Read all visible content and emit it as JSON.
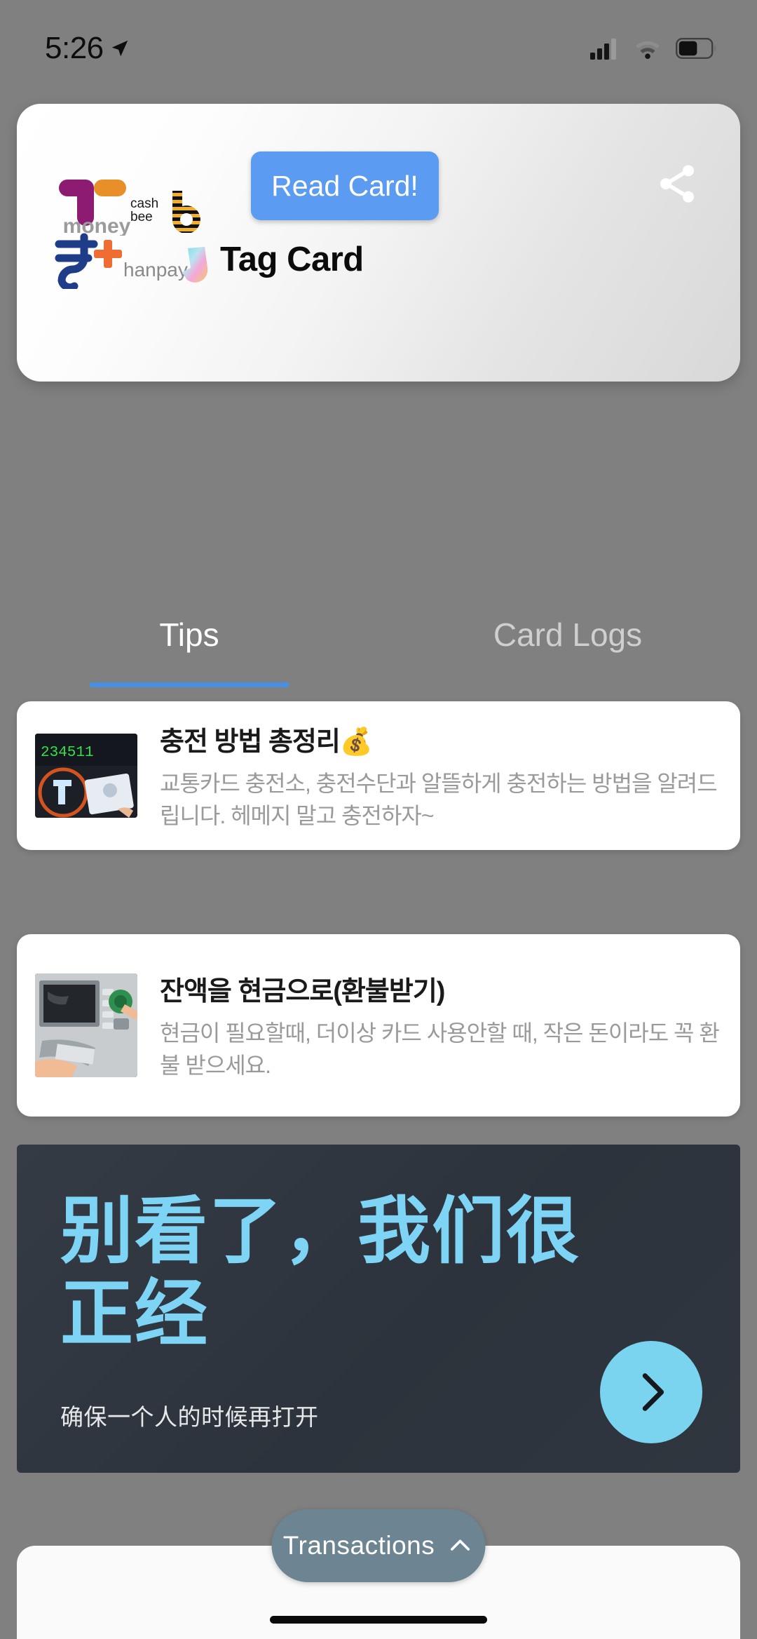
{
  "status_bar": {
    "time": "5:26",
    "location_icon": "location-arrow-icon",
    "signal_icon": "cellular-signal-icon",
    "wifi_icon": "wifi-icon",
    "battery_icon": "battery-icon"
  },
  "card": {
    "read_button_label": "Read Card!",
    "share_icon": "share-icon",
    "title": "Tag Card",
    "logos": [
      {
        "name": "tmoney-logo",
        "label": "money"
      },
      {
        "name": "cashbee-logo",
        "label_line1": "cash",
        "label_line2": "bee"
      },
      {
        "name": "railplus-logo",
        "label": "R+"
      },
      {
        "name": "hanpay-logo",
        "label": "hanpay"
      }
    ]
  },
  "tabs": {
    "active_index": 0,
    "items": [
      {
        "label": "Tips"
      },
      {
        "label": "Card Logs"
      }
    ]
  },
  "tips": [
    {
      "title": "충전 방법 총정리💰",
      "description": "교통카드 충전소, 충전수단과 알뜰하게 충전하는 방법을 알려드립니다.  헤메지 말고 충전하자~",
      "thumb_name": "charge-terminal-thumbnail",
      "thumb_display_value": "234511"
    },
    {
      "title": "잔액을 현금으로(환불받기)",
      "description": "현금이 필요할때, 더이상 카드 사용안할 때, 작은 돈이라도 꼭 환불 받으세요.",
      "thumb_name": "atm-refund-thumbnail",
      "thumb_display_value": ""
    }
  ],
  "ad": {
    "headline": "别看了，我们很正经",
    "subtext": "确保一个人的时候再打开",
    "cta_icon": "chevron-right-icon",
    "accent_color": "#7ed4f5",
    "cta_color": "#7ad4f0",
    "background_color": "#343b45"
  },
  "bottom_sheet": {
    "transactions_label": "Transactions",
    "chevron_icon": "chevron-up-icon"
  },
  "colors": {
    "page_background": "#808080",
    "primary_blue": "#5b9bf1",
    "tab_indicator": "#4a90e2"
  }
}
